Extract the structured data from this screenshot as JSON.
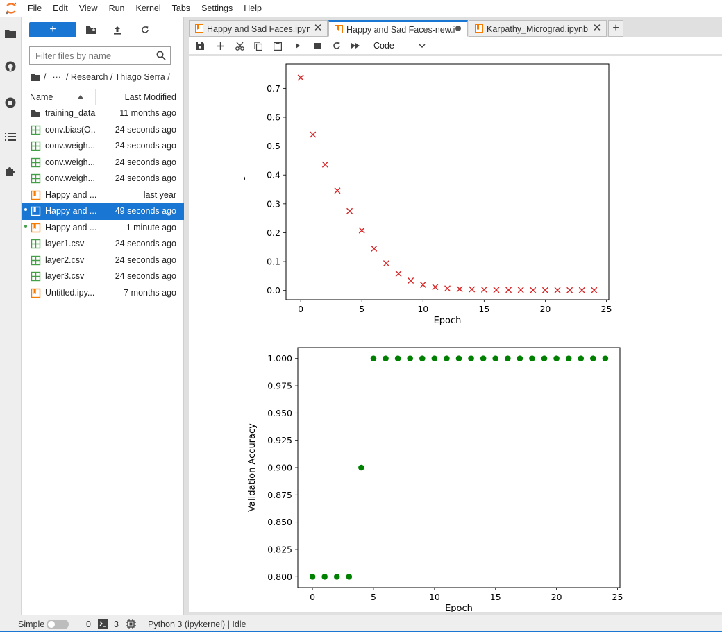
{
  "menu": {
    "items": [
      "File",
      "Edit",
      "View",
      "Run",
      "Kernel",
      "Tabs",
      "Settings",
      "Help"
    ]
  },
  "rail": {
    "icons": [
      "folder-icon",
      "github-icon",
      "running-icon",
      "toc-icon",
      "extension-icon"
    ]
  },
  "file_browser": {
    "filter_placeholder": "Filter files by name",
    "breadcrumb": [
      "/",
      "···",
      "/ Research / Thiago Serra /"
    ],
    "columns": {
      "name": "Name",
      "modified": "Last Modified"
    },
    "files": [
      {
        "name": "training_data",
        "modified": "11 months ago",
        "kind": "folder",
        "selected": false,
        "dot": ""
      },
      {
        "name": "conv.bias(O...",
        "modified": "24 seconds ago",
        "kind": "csv",
        "selected": false,
        "dot": ""
      },
      {
        "name": "conv.weigh...",
        "modified": "24 seconds ago",
        "kind": "csv",
        "selected": false,
        "dot": ""
      },
      {
        "name": "conv.weigh...",
        "modified": "24 seconds ago",
        "kind": "csv",
        "selected": false,
        "dot": ""
      },
      {
        "name": "conv.weigh...",
        "modified": "24 seconds ago",
        "kind": "csv",
        "selected": false,
        "dot": ""
      },
      {
        "name": "Happy and ...",
        "modified": "last year",
        "kind": "notebook",
        "selected": false,
        "dot": ""
      },
      {
        "name": "Happy and ...",
        "modified": "49 seconds ago",
        "kind": "notebook",
        "selected": true,
        "dot": "#ffffff"
      },
      {
        "name": "Happy and ...",
        "modified": "1 minute ago",
        "kind": "notebook",
        "selected": false,
        "dot": "#43a047"
      },
      {
        "name": "layer1.csv",
        "modified": "24 seconds ago",
        "kind": "csv",
        "selected": false,
        "dot": ""
      },
      {
        "name": "layer2.csv",
        "modified": "24 seconds ago",
        "kind": "csv",
        "selected": false,
        "dot": ""
      },
      {
        "name": "layer3.csv",
        "modified": "24 seconds ago",
        "kind": "csv",
        "selected": false,
        "dot": ""
      },
      {
        "name": "Untitled.ipy...",
        "modified": "7 months ago",
        "kind": "notebook",
        "selected": false,
        "dot": ""
      }
    ]
  },
  "tabs": [
    {
      "label": "Happy and Sad Faces.ipynb",
      "active": false,
      "dirty": false
    },
    {
      "label": "Happy and Sad Faces-new.ip",
      "active": true,
      "dirty": true
    },
    {
      "label": "Karpathy_Micrograd.ipynb",
      "active": false,
      "dirty": false
    }
  ],
  "toolbar": {
    "cell_type": "Code"
  },
  "status": {
    "mode_label": "Simple",
    "terminals": "0",
    "kernels": "3",
    "kernel_status": "Python 3 (ipykernel) | Idle"
  },
  "colors": {
    "accent": "#1976d2",
    "notebook_icon": "#f57c00",
    "csv_icon": "#43a047",
    "loss_marker": "#d62728",
    "acc_marker": "#008000"
  },
  "chart_data": [
    {
      "type": "scatter",
      "marker": "x",
      "xlabel": "Epoch",
      "ylabel": "Training Loss",
      "xlim": [
        -1.2,
        25.2
      ],
      "ylim": [
        -0.032,
        0.785
      ],
      "xticks": [
        0,
        5,
        10,
        15,
        20,
        25
      ],
      "yticks": [
        0.0,
        0.1,
        0.2,
        0.3,
        0.4,
        0.5,
        0.6,
        0.7
      ],
      "ytick_labels": [
        "0.0",
        "0.1",
        "0.2",
        "0.3",
        "0.4",
        "0.5",
        "0.6",
        "0.7"
      ],
      "x": [
        0,
        1,
        2,
        3,
        4,
        5,
        6,
        7,
        8,
        9,
        10,
        11,
        12,
        13,
        14,
        15,
        16,
        17,
        18,
        19,
        20,
        21,
        22,
        23,
        24
      ],
      "y": [
        0.737,
        0.54,
        0.436,
        0.346,
        0.275,
        0.208,
        0.145,
        0.094,
        0.058,
        0.034,
        0.02,
        0.012,
        0.007,
        0.005,
        0.004,
        0.003,
        0.002,
        0.002,
        0.002,
        0.001,
        0.001,
        0.001,
        0.001,
        0.001,
        0.001
      ]
    },
    {
      "type": "scatter",
      "marker": "o",
      "xlabel": "Epoch",
      "ylabel": "Validation Accuracy",
      "xlim": [
        -1.2,
        25.2
      ],
      "ylim": [
        0.79,
        1.01
      ],
      "xticks": [
        0,
        5,
        10,
        15,
        20,
        25
      ],
      "yticks": [
        0.8,
        0.825,
        0.85,
        0.875,
        0.9,
        0.925,
        0.95,
        0.975,
        1.0
      ],
      "ytick_labels": [
        "0.800",
        "0.825",
        "0.850",
        "0.875",
        "0.900",
        "0.925",
        "0.950",
        "0.975",
        "1.000"
      ],
      "x": [
        0,
        1,
        2,
        3,
        4,
        5,
        6,
        7,
        8,
        9,
        10,
        11,
        12,
        13,
        14,
        15,
        16,
        17,
        18,
        19,
        20,
        21,
        22,
        23,
        24
      ],
      "y": [
        0.8,
        0.8,
        0.8,
        0.8,
        0.9,
        1.0,
        1.0,
        1.0,
        1.0,
        1.0,
        1.0,
        1.0,
        1.0,
        1.0,
        1.0,
        1.0,
        1.0,
        1.0,
        1.0,
        1.0,
        1.0,
        1.0,
        1.0,
        1.0,
        1.0
      ]
    }
  ]
}
